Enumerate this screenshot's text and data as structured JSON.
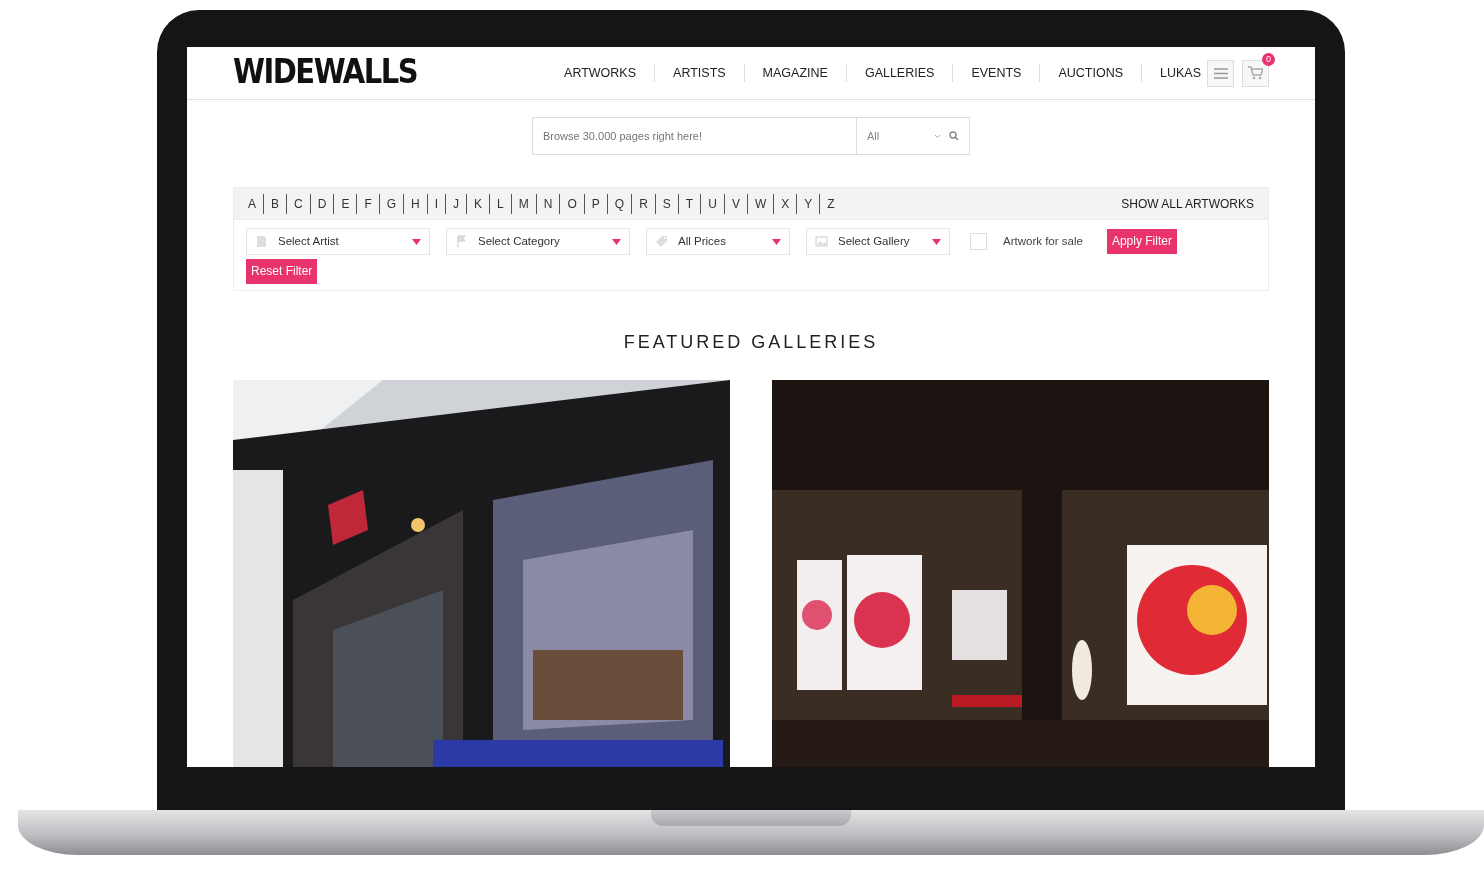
{
  "brand": "WIDEWALLS",
  "nav": [
    {
      "label": "ARTWORKS"
    },
    {
      "label": "ARTISTS"
    },
    {
      "label": "MAGAZINE"
    },
    {
      "label": "GALLERIES"
    },
    {
      "label": "EVENTS"
    },
    {
      "label": "AUCTIONS"
    }
  ],
  "user": "LUKAS",
  "cart_count": "0",
  "search": {
    "placeholder": "Browse 30.000 pages right here!",
    "scope": "All"
  },
  "letters": [
    "A",
    "B",
    "C",
    "D",
    "E",
    "F",
    "G",
    "H",
    "I",
    "J",
    "K",
    "L",
    "M",
    "N",
    "O",
    "P",
    "Q",
    "R",
    "S",
    "T",
    "U",
    "V",
    "W",
    "X",
    "Y",
    "Z"
  ],
  "show_all": "SHOW ALL ARTWORKS",
  "filters": [
    {
      "kind": "select",
      "label": "Select Artist"
    },
    {
      "kind": "select",
      "label": "Select Category"
    },
    {
      "kind": "select",
      "label": "All Prices"
    },
    {
      "kind": "select",
      "label": "Select Gallery"
    },
    {
      "kind": "checkbox",
      "label": "Artwork for sale",
      "checked": false
    }
  ],
  "buttons": [
    "Apply Filter",
    "Reset Filter"
  ],
  "section_title": "FEATURED GALLERIES"
}
